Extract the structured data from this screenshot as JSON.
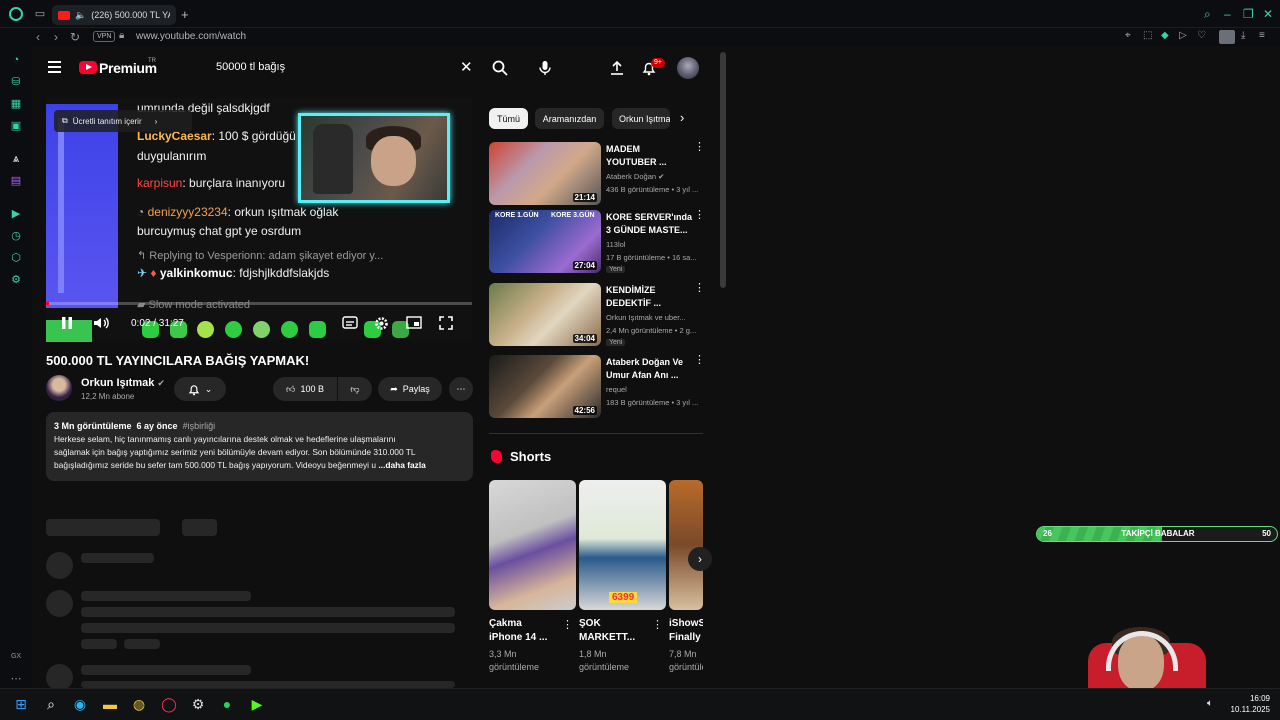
{
  "browser": {
    "tab_title": "(226) 500.000 TL YA...",
    "url": "www.youtube.com/watch",
    "vpn_label": "VPN",
    "accent": "#3ad1a8"
  },
  "youtube": {
    "brand": "Premium",
    "region": "TR",
    "search_query": "50000 tl bağış",
    "notification_count": "9+",
    "brand_color": "#ff0033"
  },
  "video": {
    "promo_label": "Ücretli tanıtım içerir",
    "time": "0:02 / 31:27",
    "progress_fraction": 0.001,
    "chat": [
      {
        "user": "",
        "text": "umrunda değil şalsdkjgdf"
      },
      {
        "user": "LuckyCaesar",
        "text": ": 100 $ gördüğü"
      },
      {
        "user": "",
        "text": "duygulanırım"
      },
      {
        "user": "karpisun",
        "text": ": burçlara inanıyoru"
      },
      {
        "user": "denizyyy23234",
        "text": ": orkun ışıtmak oğlak"
      },
      {
        "user": "",
        "text": "burcuymuş chat gpt ye osrdum"
      },
      {
        "user": "",
        "text": "Replying to Vesperionn: adam şikayet ediyor y..."
      },
      {
        "user": "yalkinkomuc",
        "text": ": fdjshjlkddfslakjds"
      },
      {
        "user": "",
        "text": "Slow mode activated"
      }
    ]
  },
  "title": "500.000 TL YAYINCILARA BAĞIŞ YAPMAK!",
  "channel": {
    "name": "Orkun Işıtmak",
    "subscribers": "12,2 Mn abone",
    "likes": "100 B",
    "share_label": "Paylaş"
  },
  "description": {
    "views": "3 Mn görüntüleme",
    "age": "6 ay önce",
    "tag": "#işbirliği",
    "lines": [
      "Herkese selam, hiç tanınmamış canlı yayıncılarına destek olmak ve hedeflerine ulaşmalarını",
      "sağlamak için bağış yaptığımız serimiz yeni bölümüyle devam ediyor. Son bölümünde 310.000 TL",
      "bağışladığımız seride bu sefer tam 500.000 TL bağış yapıyorum. Videoyu beğenmeyi u"
    ],
    "more": "...daha fazla"
  },
  "chips": [
    "Tümü",
    "Aramanızdan",
    "Orkun Işıtmak"
  ],
  "recommendations": [
    {
      "title_l1": "MADEM",
      "title_l2": "YOUTUBER ...",
      "channel": "Ataberk Doğan",
      "views": "436 B görüntüleme • 3 yıl ...",
      "duration": "21:14",
      "badge": ""
    },
    {
      "title_l1": "KORE SERVER'ında",
      "title_l2": "3 GÜNDE MASTE...",
      "channel": "113lol",
      "views": "17 B görüntüleme • 16 sa...",
      "duration": "27:04",
      "badge": "Yeni"
    },
    {
      "title_l1": "KENDİMİZE",
      "title_l2": "DEDEKTİF ...",
      "channel": "Orkun Işıtmak ve uber...",
      "views": "2,4 Mn görüntüleme • 2 g...",
      "duration": "34:04",
      "badge": "Yeni"
    },
    {
      "title_l1": "Ataberk Doğan Ve",
      "title_l2": "Umur Afan Anı ...",
      "channel": "requel",
      "views": "183 B görüntüleme • 3 yıl ...",
      "duration": "42:56",
      "badge": ""
    }
  ],
  "thumb_texts": {
    "kore_left": "KORE 1.GÜN",
    "kore_right": "KORE 3.GÜN"
  },
  "shorts": {
    "heading": "Shorts",
    "items": [
      {
        "title_l1": "Çakma",
        "title_l2": "iPhone 14 ...",
        "views_l1": "3,3 Mn",
        "views_l2": "görüntüleme"
      },
      {
        "title_l1": "ŞOK",
        "title_l2": "MARKETT...",
        "views_l1": "1,8 Mn",
        "views_l2": "görüntüleme"
      },
      {
        "title_l1": "iShowS",
        "title_l2": "Finally",
        "views_l1": "7,8 Mn",
        "views_l2": "görüntüleme"
      }
    ],
    "price_tag": "6399"
  },
  "stream_goal": {
    "start": "26",
    "label": "TAKİPÇİ BABALAR",
    "end": "50",
    "fill_fraction": 0.52
  },
  "taskbar": {
    "time": "16:09",
    "date": "10.11.2025"
  },
  "sidebar_bottom_label": "GX"
}
